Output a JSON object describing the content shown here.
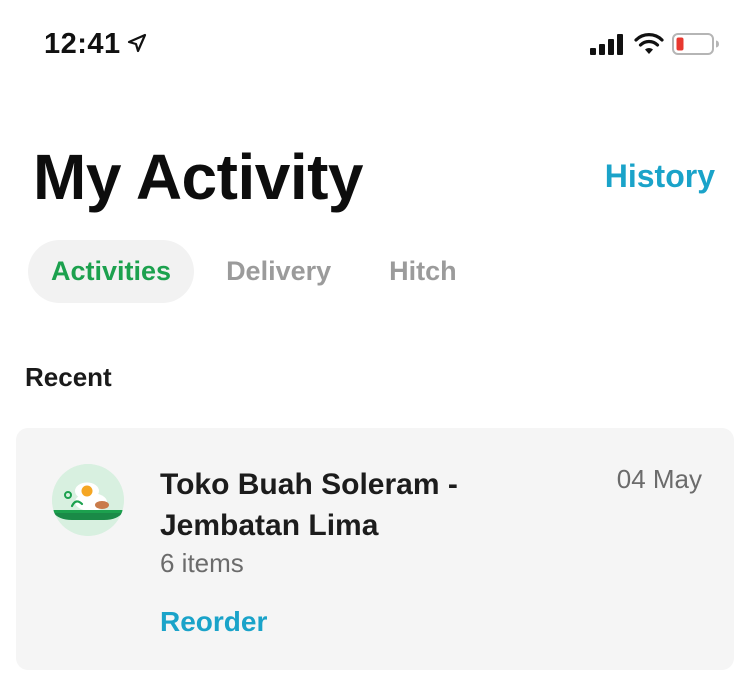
{
  "status_bar": {
    "time": "12:41",
    "icons": [
      "location-arrow-icon",
      "signal-bars-icon",
      "wifi-icon",
      "battery-low-icon"
    ],
    "battery_color": "#e8382f"
  },
  "header": {
    "title": "My Activity",
    "history_label": "History"
  },
  "tabs": [
    {
      "label": "Activities",
      "active": true
    },
    {
      "label": "Delivery",
      "active": false
    },
    {
      "label": "Hitch",
      "active": false
    }
  ],
  "recent": {
    "section_label": "Recent",
    "order": {
      "merchant_name": "Toko Buah Soleram - Jembatan Lima",
      "items": "6 items",
      "date": "04 May",
      "reorder_label": "Reorder",
      "avatar_icon": "food-plate-icon"
    }
  },
  "colors": {
    "accent_green": "#1ca14e",
    "link_blue": "#1aa3c9",
    "card_background": "#f5f5f5"
  }
}
